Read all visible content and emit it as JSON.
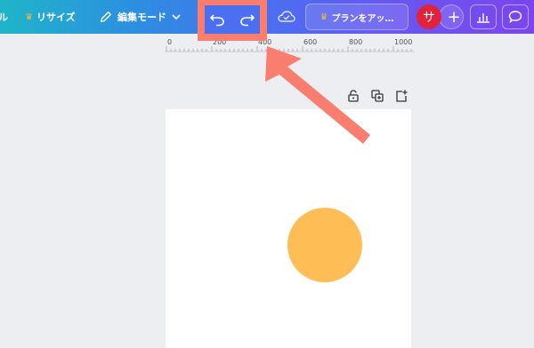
{
  "toolbar": {
    "left_partial_label": "ル",
    "resize_label": "リサイズ",
    "edit_mode_label": "編集モード",
    "plan_label": "プランをアッ…",
    "avatar_initial": "サ",
    "plus_label": "+"
  },
  "ruler": {
    "ticks": [
      "0",
      "200",
      "400",
      "600",
      "800",
      "1000"
    ]
  },
  "colors": {
    "highlight": "#fa7e70",
    "circle": "#ffbd55",
    "avatar": "#e0223a",
    "crown": "#f4b93e"
  },
  "icons": [
    "pencil-icon",
    "chevron-down-icon",
    "undo-icon",
    "redo-icon",
    "cloud-check-icon",
    "crown-icon",
    "chart-icon",
    "comment-icon",
    "lock-icon",
    "duplicate-icon",
    "add-page-icon"
  ]
}
